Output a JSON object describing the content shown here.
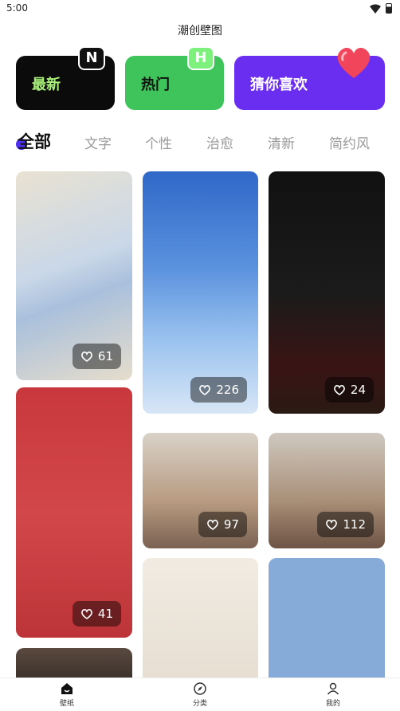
{
  "status_bar": {
    "time": "5:00"
  },
  "app": {
    "title": "潮创壁图"
  },
  "categories": [
    {
      "label": "最新",
      "badge": "N"
    },
    {
      "label": "热门",
      "badge": "H"
    },
    {
      "label": "猜你喜欢"
    }
  ],
  "tabs": [
    "全部",
    "文字",
    "个性",
    "治愈",
    "清新",
    "简约风"
  ],
  "active_tab": "全部",
  "wallpapers": [
    {
      "likes": "61"
    },
    {
      "likes": "226"
    },
    {
      "likes": "24"
    },
    {
      "likes": "41"
    },
    {
      "likes": "97"
    },
    {
      "likes": "112"
    }
  ],
  "bottom_nav": [
    {
      "label": "壁纸",
      "icon": "home-icon"
    },
    {
      "label": "分类",
      "icon": "compass-icon"
    },
    {
      "label": "我的",
      "icon": "user-icon"
    }
  ],
  "colors": {
    "accent": "#4c2ff0",
    "latest_card": "#0b0b0b",
    "hot_card": "#3ec45a",
    "fav_card": "#6a2ef0"
  }
}
